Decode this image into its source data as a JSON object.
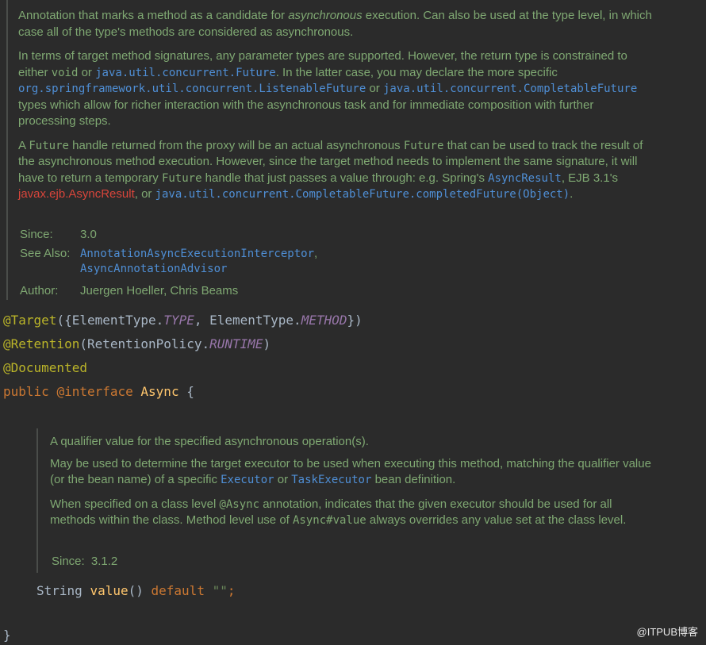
{
  "doc1": {
    "p1": {
      "t1": "Annotation that marks a method as a candidate for ",
      "t2": "asynchronous",
      "t3": " execution. Can also be used at the type level, in which case all of the type's methods are considered as asynchronous."
    },
    "p2": {
      "t1": "In terms of target method signatures, any parameter types are supported. However, the return type is constrained to either ",
      "code_void": "void",
      "t2": " or ",
      "link_future": "java.util.concurrent.Future",
      "t3": ". In the latter case, you may declare the more specific ",
      "link_listenable": "org.springframework.util.concurrent.ListenableFuture",
      "t4": " or ",
      "link_completable": "java.util.concurrent.CompletableFuture",
      "t5": " types which allow for richer interaction with the asynchronous task and for immediate composition with further processing steps."
    },
    "p3": {
      "t1": "A ",
      "code_future1": "Future",
      "t2": " handle returned from the proxy will be an actual asynchronous ",
      "code_future2": "Future",
      "t3": " that can be used to track the result of the asynchronous method execution. However, since the target method needs to implement the same signature, it will have to return a temporary ",
      "code_future3": "Future",
      "t4": " handle that just passes a value through: e.g. Spring's ",
      "link_asyncresult": "AsyncResult",
      "t5": ", EJB 3.1's ",
      "err_ejb": "javax.ejb.AsyncResult",
      "t6": ", or ",
      "link_completed": "java.util.concurrent.CompletableFuture.completedFuture(Object)",
      "t7": "."
    },
    "tags": {
      "since_label": "Since:",
      "since_value": "3.0",
      "seealso_label": "See Also:",
      "seealso_1": "AnnotationAsyncExecutionInterceptor",
      "seealso_1_suffix": ",",
      "seealso_2": "AsyncAnnotationAdvisor",
      "author_label": "Author:",
      "author_value": "Juergen Hoeller, Chris Beams"
    }
  },
  "code": {
    "line1": {
      "ann": "@Target",
      "a": "({ElementType.",
      "c1": "TYPE",
      "b": ", ElementType.",
      "c2": "METHOD",
      "d": "})"
    },
    "line2": {
      "ann": "@Retention",
      "a": "(RetentionPolicy.",
      "c1": "RUNTIME",
      "b": ")"
    },
    "line3": {
      "ann": "@Documented"
    },
    "line4": {
      "kw1": "public",
      "kw2": "@interface",
      "name": "Async",
      "brace": "{"
    },
    "method": {
      "type": "String",
      "name": "value",
      "parens": "()",
      "kw": "default",
      "val": "\"\"",
      "semi": ";"
    },
    "close": "}"
  },
  "doc2": {
    "p1": "A qualifier value for the specified asynchronous operation(s).",
    "p2": {
      "t1": "May be used to determine the target executor to be used when executing this method, matching the qualifier value (or the bean name) of a specific ",
      "link_executor": "Executor",
      "t2": " or ",
      "link_taskexecutor": "TaskExecutor",
      "t3": " bean definition."
    },
    "p3": {
      "t1": "When specified on a class level ",
      "code_async": "@Async",
      "t2": " annotation, indicates that the given executor should be used for all methods within the class. Method level use of ",
      "code_value": "Async#value",
      "t3": " always overrides any value set at the class level."
    },
    "since_label": "Since:",
    "since_value": "3.1.2"
  },
  "watermark": "@ITPUB博客"
}
